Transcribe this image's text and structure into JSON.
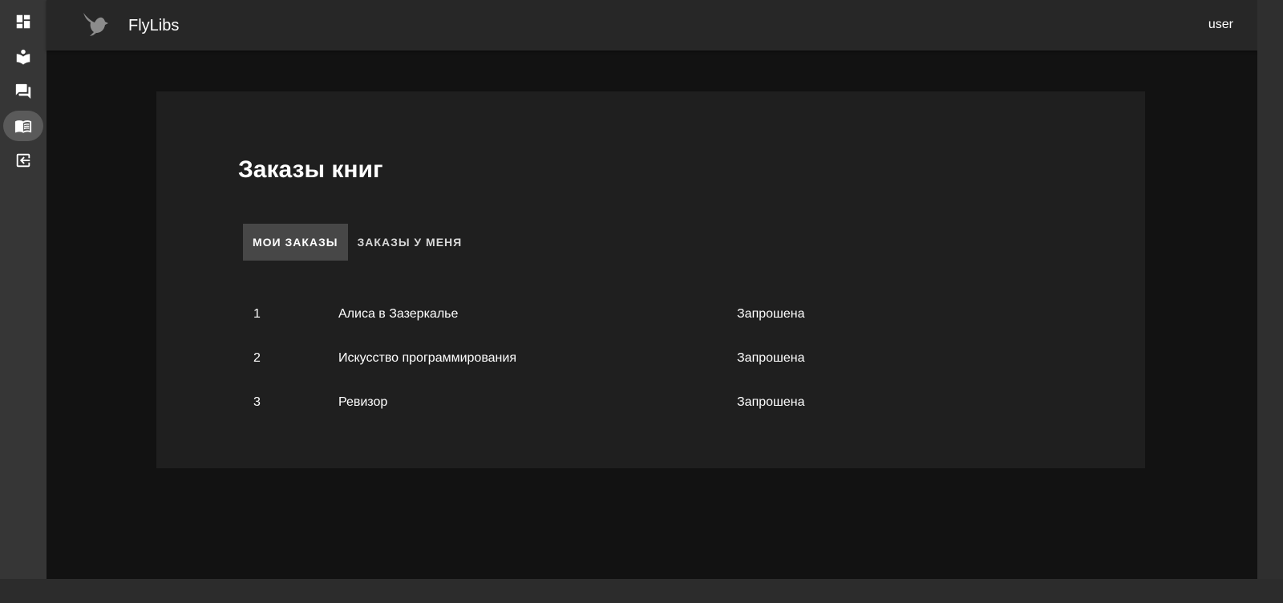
{
  "app": {
    "title": "FlyLibs",
    "user": "user"
  },
  "sidebar": {
    "items": [
      {
        "icon": "dashboard-icon",
        "active": false
      },
      {
        "icon": "reader-icon",
        "active": false
      },
      {
        "icon": "forum-icon",
        "active": false
      },
      {
        "icon": "book-icon",
        "active": true
      },
      {
        "icon": "logout-icon",
        "active": false
      }
    ]
  },
  "page": {
    "title": "Заказы книг",
    "tabs": [
      {
        "label": "Мои заказы",
        "active": true
      },
      {
        "label": "Заказы у меня",
        "active": false
      }
    ]
  },
  "orders": [
    {
      "num": "1",
      "title": "Алиса в Зазеркалье",
      "status": "Запрошена"
    },
    {
      "num": "2",
      "title": "Искусство программирования",
      "status": "Запрошена"
    },
    {
      "num": "3",
      "title": "Ревизор",
      "status": "Запрошена"
    }
  ],
  "colors": {
    "background": "#121212",
    "sidebar": "#363636",
    "appbar": "#272727",
    "card": "#1f1f1f",
    "active_tab": "#474747"
  }
}
